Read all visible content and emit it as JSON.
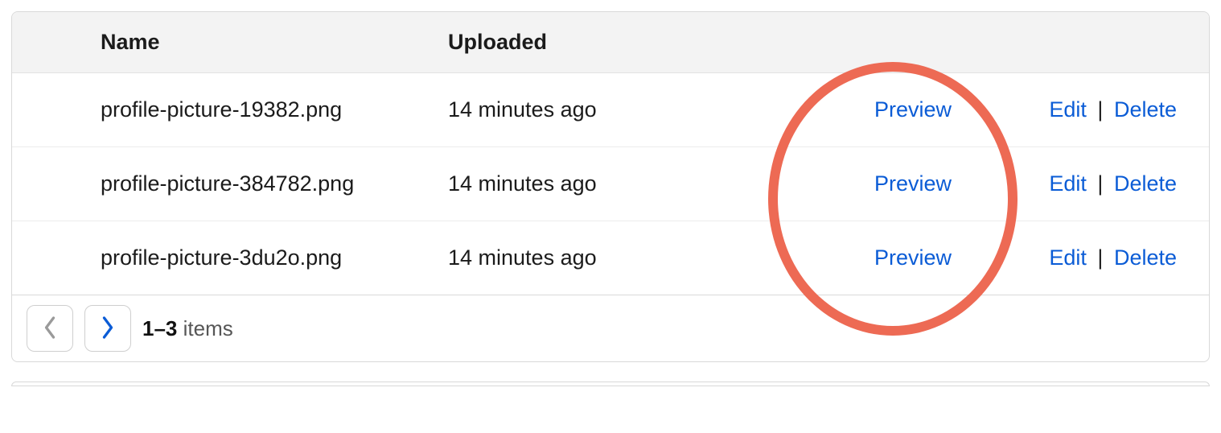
{
  "table": {
    "columns": {
      "name": "Name",
      "uploaded": "Uploaded"
    },
    "rows": [
      {
        "name": "profile-picture-19382.png",
        "uploaded": "14 minutes ago",
        "preview": "Preview",
        "edit": "Edit",
        "delete": "Delete"
      },
      {
        "name": "profile-picture-384782.png",
        "uploaded": "14 minutes ago",
        "preview": "Preview",
        "edit": "Edit",
        "delete": "Delete"
      },
      {
        "name": "profile-picture-3du2o.png",
        "uploaded": "14 minutes ago",
        "preview": "Preview",
        "edit": "Edit",
        "delete": "Delete"
      }
    ]
  },
  "pagination": {
    "range": "1–3",
    "items_label": "items"
  },
  "separator": "|"
}
